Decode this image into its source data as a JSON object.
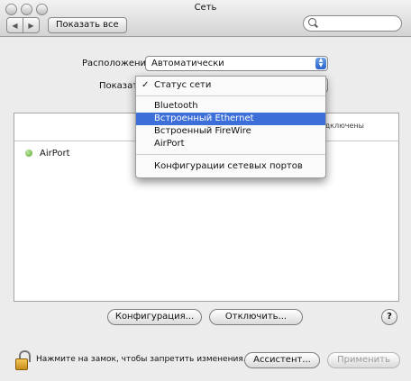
{
  "window": {
    "title": "Сеть"
  },
  "toolbar": {
    "back_glyph": "◀",
    "forward_glyph": "▶",
    "show_all_label": "Показать все",
    "search_placeholder": ""
  },
  "location": {
    "label": "Расположение:",
    "value": "Автоматически"
  },
  "show": {
    "label": "Показать"
  },
  "menu": {
    "items": [
      {
        "label": "Статус сети",
        "checked": true
      },
      {
        "label": "Bluetooth"
      },
      {
        "label": "Встроенный Ethernet",
        "highlighted": true
      },
      {
        "label": "Встроенный FireWire"
      },
      {
        "label": "AirPort"
      },
      {
        "label": "Конфигурации сетевых портов"
      }
    ]
  },
  "services": [
    {
      "name": "AirPort",
      "status_text": "дключены",
      "status_color": "#5aa63a"
    }
  ],
  "buttons": {
    "configure": "Конфигурация...",
    "disconnect": "Отключить...",
    "help": "?",
    "assistant": "Ассистент...",
    "apply": "Применить"
  },
  "lock": {
    "text": "Нажмите на замок, чтобы запретить изменения."
  },
  "colors": {
    "highlight": "#3d6fd8",
    "accent": "#2a62c8"
  }
}
